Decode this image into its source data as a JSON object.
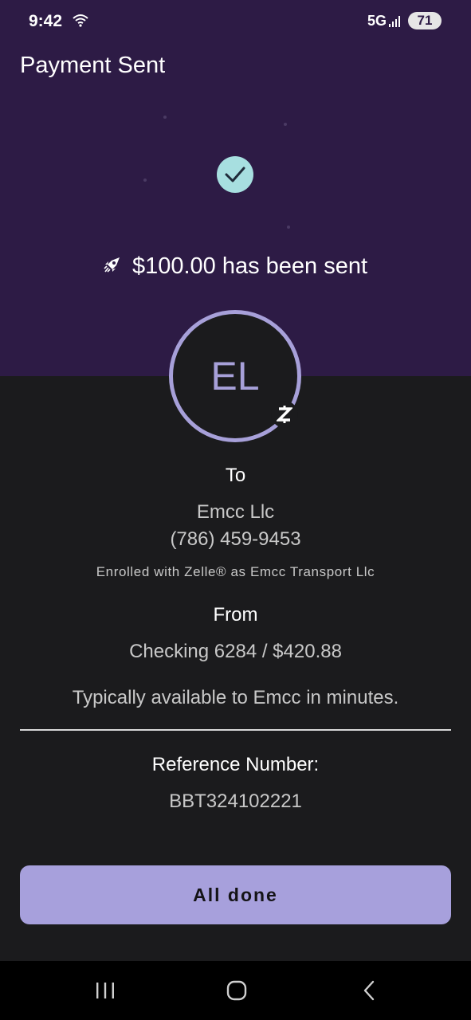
{
  "status_bar": {
    "time": "9:42",
    "network": "5G",
    "battery": "71"
  },
  "header": {
    "title": "Payment Sent"
  },
  "confirmation": {
    "message": "$100.00 has been sent"
  },
  "recipient": {
    "initials": "EL",
    "to_label": "To",
    "name": "Emcc Llc",
    "phone": "(786) 459-9453",
    "enrolled_note": "Enrolled with Zelle® as Emcc Transport Llc"
  },
  "source": {
    "from_label": "From",
    "account": "Checking 6284 / $420.88",
    "availability": "Typically available to Emcc in minutes."
  },
  "reference": {
    "label": "Reference Number:",
    "value": "BBT324102221"
  },
  "actions": {
    "done_label": "All done"
  },
  "colors": {
    "header_bg": "#2d1b45",
    "body_bg": "#1b1b1d",
    "accent": "#a7a0dc",
    "check_bg": "#a7dfe0"
  }
}
